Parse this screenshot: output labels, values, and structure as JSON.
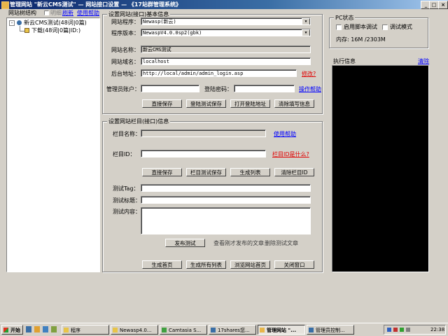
{
  "window": {
    "title": "管理网站 \"新云CMS测试\" — 网站接口设置 — 《17站群管理系统》",
    "min_glyph": "_",
    "max_glyph": "□",
    "close_glyph": "×"
  },
  "tree": {
    "title": "网站树结构",
    "expand_label": "明细",
    "refresh_label": "刷新",
    "help_label": "使用帮助",
    "items": [
      "新云CMS测试(48词|0篇)",
      "下载(48词|0篇|ID:)"
    ]
  },
  "site": {
    "group_title": "设置网站(接口)基本信息",
    "program_label": "网站程序：",
    "program_value": "Newasp(新云)",
    "version_label": "程序版本：",
    "version_value": "NewaspV4.0.0sp2(gbk)",
    "name_label": "网站名称：",
    "name_value": "新云CMS测试",
    "domain_label": "网站域名：",
    "domain_value": "localhost",
    "admin_label": "后台地址：",
    "admin_value": "http://local/admin/admin_login.asp",
    "modify_link": "修改?",
    "account_label": "管理员账户：",
    "account_value": "",
    "password_label": "登陆密码：",
    "password_value": "",
    "op_help_link": "操作帮助",
    "buttons": [
      "直接保存",
      "登陆测试保存",
      "打开登陆地址",
      "清除填写信息"
    ]
  },
  "column": {
    "group_title": "设置网站栏目(接口)信息",
    "name_label": "栏目名称：",
    "name_value": "",
    "help_link": "使用帮助",
    "id_label": "栏目ID：",
    "id_value": "",
    "what_link": "栏目ID是什么?",
    "buttons": [
      "直接保存",
      "栏目测试保存",
      "生成列表",
      "清除栏目ID"
    ]
  },
  "test": {
    "tag_label": "测试Tag：",
    "tag_value": "",
    "title_label": "测试标题：",
    "title_value": "",
    "content_label": "测试内容：",
    "content_value": "",
    "publish_button": "发布测试",
    "view_text": "查看刚才发布的文章",
    "delete_text": "删除测试文章"
  },
  "bottom_buttons": [
    "生成首页",
    "生成所有列表",
    "浏览网站首页",
    "关闭窗口"
  ],
  "pc": {
    "group_title": "PC状态",
    "script_debug_label": "启用脚本调试",
    "debug_label": "调试模式",
    "memory_text": "内存: 16M /2303M"
  },
  "exec": {
    "group_title": "执行信息",
    "clear_link": "清除"
  },
  "taskbar": {
    "start_label": "开始",
    "tasks": [
      "程序",
      "Newasp4.0...",
      "Camtasia S...",
      "17shares您...",
      "管理网站 \"...",
      "管理员控制..."
    ],
    "clock": "22:38"
  },
  "colors": {
    "titlebar_start": "#0a246a",
    "face": "#d4d0c8",
    "link": "#0000ff",
    "warn_link": "#e00000",
    "exec_panel": "#000000"
  }
}
